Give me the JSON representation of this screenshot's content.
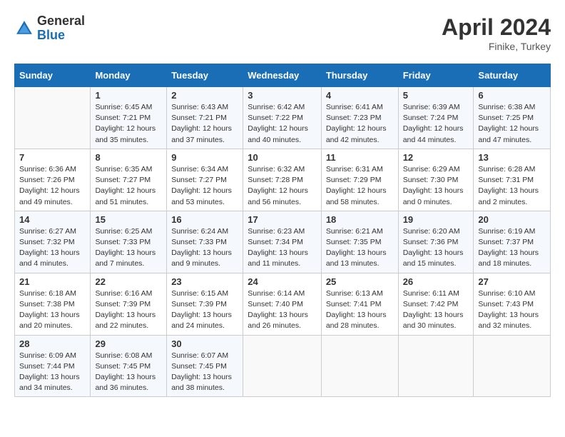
{
  "header": {
    "logo_general": "General",
    "logo_blue": "Blue",
    "month_year": "April 2024",
    "location": "Finike, Turkey"
  },
  "columns": [
    "Sunday",
    "Monday",
    "Tuesday",
    "Wednesday",
    "Thursday",
    "Friday",
    "Saturday"
  ],
  "weeks": [
    [
      {
        "day": "",
        "sunrise": "",
        "sunset": "",
        "daylight": ""
      },
      {
        "day": "1",
        "sunrise": "Sunrise: 6:45 AM",
        "sunset": "Sunset: 7:21 PM",
        "daylight": "Daylight: 12 hours and 35 minutes."
      },
      {
        "day": "2",
        "sunrise": "Sunrise: 6:43 AM",
        "sunset": "Sunset: 7:21 PM",
        "daylight": "Daylight: 12 hours and 37 minutes."
      },
      {
        "day": "3",
        "sunrise": "Sunrise: 6:42 AM",
        "sunset": "Sunset: 7:22 PM",
        "daylight": "Daylight: 12 hours and 40 minutes."
      },
      {
        "day": "4",
        "sunrise": "Sunrise: 6:41 AM",
        "sunset": "Sunset: 7:23 PM",
        "daylight": "Daylight: 12 hours and 42 minutes."
      },
      {
        "day": "5",
        "sunrise": "Sunrise: 6:39 AM",
        "sunset": "Sunset: 7:24 PM",
        "daylight": "Daylight: 12 hours and 44 minutes."
      },
      {
        "day": "6",
        "sunrise": "Sunrise: 6:38 AM",
        "sunset": "Sunset: 7:25 PM",
        "daylight": "Daylight: 12 hours and 47 minutes."
      }
    ],
    [
      {
        "day": "7",
        "sunrise": "Sunrise: 6:36 AM",
        "sunset": "Sunset: 7:26 PM",
        "daylight": "Daylight: 12 hours and 49 minutes."
      },
      {
        "day": "8",
        "sunrise": "Sunrise: 6:35 AM",
        "sunset": "Sunset: 7:27 PM",
        "daylight": "Daylight: 12 hours and 51 minutes."
      },
      {
        "day": "9",
        "sunrise": "Sunrise: 6:34 AM",
        "sunset": "Sunset: 7:27 PM",
        "daylight": "Daylight: 12 hours and 53 minutes."
      },
      {
        "day": "10",
        "sunrise": "Sunrise: 6:32 AM",
        "sunset": "Sunset: 7:28 PM",
        "daylight": "Daylight: 12 hours and 56 minutes."
      },
      {
        "day": "11",
        "sunrise": "Sunrise: 6:31 AM",
        "sunset": "Sunset: 7:29 PM",
        "daylight": "Daylight: 12 hours and 58 minutes."
      },
      {
        "day": "12",
        "sunrise": "Sunrise: 6:29 AM",
        "sunset": "Sunset: 7:30 PM",
        "daylight": "Daylight: 13 hours and 0 minutes."
      },
      {
        "day": "13",
        "sunrise": "Sunrise: 6:28 AM",
        "sunset": "Sunset: 7:31 PM",
        "daylight": "Daylight: 13 hours and 2 minutes."
      }
    ],
    [
      {
        "day": "14",
        "sunrise": "Sunrise: 6:27 AM",
        "sunset": "Sunset: 7:32 PM",
        "daylight": "Daylight: 13 hours and 4 minutes."
      },
      {
        "day": "15",
        "sunrise": "Sunrise: 6:25 AM",
        "sunset": "Sunset: 7:33 PM",
        "daylight": "Daylight: 13 hours and 7 minutes."
      },
      {
        "day": "16",
        "sunrise": "Sunrise: 6:24 AM",
        "sunset": "Sunset: 7:33 PM",
        "daylight": "Daylight: 13 hours and 9 minutes."
      },
      {
        "day": "17",
        "sunrise": "Sunrise: 6:23 AM",
        "sunset": "Sunset: 7:34 PM",
        "daylight": "Daylight: 13 hours and 11 minutes."
      },
      {
        "day": "18",
        "sunrise": "Sunrise: 6:21 AM",
        "sunset": "Sunset: 7:35 PM",
        "daylight": "Daylight: 13 hours and 13 minutes."
      },
      {
        "day": "19",
        "sunrise": "Sunrise: 6:20 AM",
        "sunset": "Sunset: 7:36 PM",
        "daylight": "Daylight: 13 hours and 15 minutes."
      },
      {
        "day": "20",
        "sunrise": "Sunrise: 6:19 AM",
        "sunset": "Sunset: 7:37 PM",
        "daylight": "Daylight: 13 hours and 18 minutes."
      }
    ],
    [
      {
        "day": "21",
        "sunrise": "Sunrise: 6:18 AM",
        "sunset": "Sunset: 7:38 PM",
        "daylight": "Daylight: 13 hours and 20 minutes."
      },
      {
        "day": "22",
        "sunrise": "Sunrise: 6:16 AM",
        "sunset": "Sunset: 7:39 PM",
        "daylight": "Daylight: 13 hours and 22 minutes."
      },
      {
        "day": "23",
        "sunrise": "Sunrise: 6:15 AM",
        "sunset": "Sunset: 7:39 PM",
        "daylight": "Daylight: 13 hours and 24 minutes."
      },
      {
        "day": "24",
        "sunrise": "Sunrise: 6:14 AM",
        "sunset": "Sunset: 7:40 PM",
        "daylight": "Daylight: 13 hours and 26 minutes."
      },
      {
        "day": "25",
        "sunrise": "Sunrise: 6:13 AM",
        "sunset": "Sunset: 7:41 PM",
        "daylight": "Daylight: 13 hours and 28 minutes."
      },
      {
        "day": "26",
        "sunrise": "Sunrise: 6:11 AM",
        "sunset": "Sunset: 7:42 PM",
        "daylight": "Daylight: 13 hours and 30 minutes."
      },
      {
        "day": "27",
        "sunrise": "Sunrise: 6:10 AM",
        "sunset": "Sunset: 7:43 PM",
        "daylight": "Daylight: 13 hours and 32 minutes."
      }
    ],
    [
      {
        "day": "28",
        "sunrise": "Sunrise: 6:09 AM",
        "sunset": "Sunset: 7:44 PM",
        "daylight": "Daylight: 13 hours and 34 minutes."
      },
      {
        "day": "29",
        "sunrise": "Sunrise: 6:08 AM",
        "sunset": "Sunset: 7:45 PM",
        "daylight": "Daylight: 13 hours and 36 minutes."
      },
      {
        "day": "30",
        "sunrise": "Sunrise: 6:07 AM",
        "sunset": "Sunset: 7:45 PM",
        "daylight": "Daylight: 13 hours and 38 minutes."
      },
      {
        "day": "",
        "sunrise": "",
        "sunset": "",
        "daylight": ""
      },
      {
        "day": "",
        "sunrise": "",
        "sunset": "",
        "daylight": ""
      },
      {
        "day": "",
        "sunrise": "",
        "sunset": "",
        "daylight": ""
      },
      {
        "day": "",
        "sunrise": "",
        "sunset": "",
        "daylight": ""
      }
    ]
  ]
}
